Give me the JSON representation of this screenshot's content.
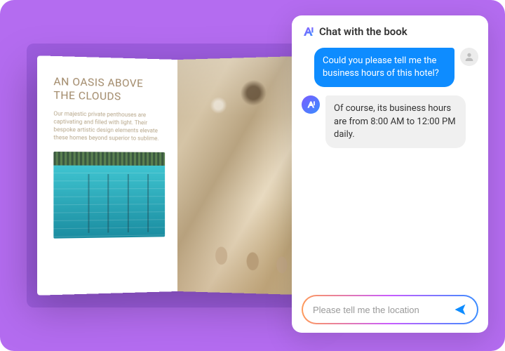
{
  "book": {
    "heading": "AN OASIS ABOVE THE CLOUDS",
    "body": "Our majestic private penthouses are captivating and filled with light. Their bespoke artistic design elements elevate these homes beyond superior to sublime."
  },
  "chat": {
    "title": "Chat with the book",
    "messages": [
      {
        "role": "user",
        "text": "Could you please tell me the business hours of this hotel?"
      },
      {
        "role": "bot",
        "text": "Of course, its business hours are from 8:00 AM to 12:00 PM daily."
      }
    ],
    "input_value": "Please tell me the location"
  },
  "icons": {
    "ai_logo": "ai-logo",
    "user_avatar": "user-avatar-icon",
    "send": "send-icon"
  },
  "colors": {
    "bg": "#b46cf0",
    "user_bubble": "#0e8cff",
    "bot_bubble": "#f0f0f0"
  }
}
